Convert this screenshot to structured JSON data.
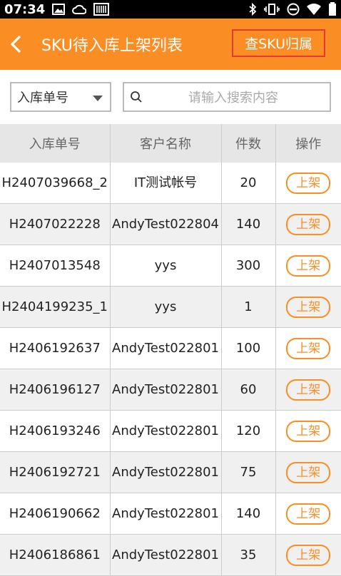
{
  "status": {
    "time": "07:34"
  },
  "header": {
    "title": "SKU待入库上架列表",
    "sku_button": "查SKU归属"
  },
  "filter": {
    "selected": "入库单号",
    "search_placeholder": "请输入搜索内容"
  },
  "table": {
    "columns": [
      "入库单号",
      "客户名称",
      "件数",
      "操作"
    ],
    "rows": [
      {
        "no": "H2407039668_2",
        "customer": "IT测试帐号",
        "qty": "20",
        "action": "上架"
      },
      {
        "no": "H2407022228",
        "customer": "AndyTest022804",
        "qty": "140",
        "action": "上架"
      },
      {
        "no": "H2407013548",
        "customer": "yys",
        "qty": "300",
        "action": "上架"
      },
      {
        "no": "H2404199235_1",
        "customer": "yys",
        "qty": "1",
        "action": "上架"
      },
      {
        "no": "H2406192637",
        "customer": "AndyTest022801",
        "qty": "100",
        "action": "上架"
      },
      {
        "no": "H2406196127",
        "customer": "AndyTest022801",
        "qty": "60",
        "action": "上架"
      },
      {
        "no": "H2406193246",
        "customer": "AndyTest022801",
        "qty": "120",
        "action": "上架"
      },
      {
        "no": "H2406192721",
        "customer": "AndyTest022801",
        "qty": "75",
        "action": "上架"
      },
      {
        "no": "H2406190662",
        "customer": "AndyTest022801",
        "qty": "140",
        "action": "上架"
      },
      {
        "no": "H2406186861",
        "customer": "AndyTest022801",
        "qty": "35",
        "action": "上架"
      }
    ]
  }
}
